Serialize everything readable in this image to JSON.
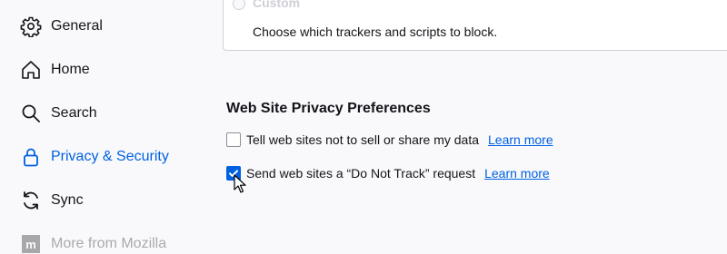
{
  "sidebar": {
    "items": [
      {
        "label": "General",
        "icon": "gear-icon"
      },
      {
        "label": "Home",
        "icon": "home-icon"
      },
      {
        "label": "Search",
        "icon": "search-icon"
      },
      {
        "label": "Privacy & Security",
        "icon": "lock-icon",
        "active": true
      },
      {
        "label": "Sync",
        "icon": "sync-icon"
      },
      {
        "label": "More from Mozilla",
        "icon": "mozilla-icon"
      }
    ]
  },
  "main": {
    "tracker_box": {
      "radio_label": "Custom",
      "description": "Choose which trackers and scripts to block."
    },
    "section_title": "Web Site Privacy Preferences",
    "options": [
      {
        "label": "Tell web sites not to sell or share my data",
        "checked": false,
        "link": "Learn more"
      },
      {
        "label": "Send web sites a “Do Not Track” request",
        "checked": true,
        "link": "Learn more"
      }
    ]
  },
  "colors": {
    "accent": "#0061e0",
    "background": "#f9f9fb",
    "text": "#15141a",
    "border": "#cfcfd8"
  }
}
